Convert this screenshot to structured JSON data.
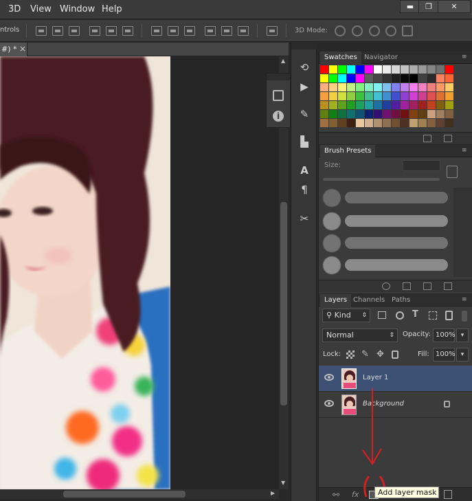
{
  "menu": {
    "items": [
      "3D",
      "View",
      "Window",
      "Help"
    ]
  },
  "window_controls": {
    "minimize": "▬",
    "restore": "❐",
    "close": "✕"
  },
  "options_bar": {
    "label": "ntrols",
    "mode_label": "3D Mode:"
  },
  "document_tab": {
    "title": "#) *",
    "close": "×"
  },
  "swatches_panel": {
    "tabs": [
      "Swatches",
      "Navigator"
    ],
    "colors": [
      [
        "#ff0000",
        "#ffff00",
        "#00ff00",
        "#00ffff",
        "#0000ff",
        "#ff00ff",
        "#ffffff",
        "#ebebeb",
        "#d6d6d6",
        "#c2c2c2",
        "#adadad",
        "#999999",
        "#858585",
        "#707070",
        "#ff0000"
      ],
      [
        "#ffff00",
        "#00ff00",
        "#00ffff",
        "#0000ff",
        "#ff00ff",
        "#5c5c5c",
        "#474747",
        "#333333",
        "#1f1f1f",
        "#0a0a0a",
        "#000000",
        "#404040",
        "#2a2a2a",
        "#ff8060",
        "#ff6633"
      ],
      [
        "#ffb080",
        "#ffd080",
        "#fff080",
        "#c0f080",
        "#80f080",
        "#80f0c0",
        "#80f0f0",
        "#80c0f0",
        "#8080f0",
        "#c080f0",
        "#f080f0",
        "#f080c0",
        "#f08080",
        "#ff9966",
        "#ffcc66"
      ],
      [
        "#f5a040",
        "#f0d040",
        "#d0e040",
        "#90d040",
        "#40c040",
        "#40c090",
        "#40c0d0",
        "#4090d0",
        "#4050d0",
        "#9040d0",
        "#d040d0",
        "#d04090",
        "#e05050",
        "#e07030",
        "#f0a030"
      ],
      [
        "#b89020",
        "#a0b020",
        "#60a020",
        "#20a020",
        "#20a060",
        "#20a0a0",
        "#2070a0",
        "#2040a0",
        "#5020a0",
        "#a020a0",
        "#a02060",
        "#a02020",
        "#c04020",
        "#806010",
        "#a0a010"
      ],
      [
        "#608010",
        "#108010",
        "#107040",
        "#107070",
        "#105070",
        "#102070",
        "#301070",
        "#701070",
        "#701040",
        "#701010",
        "#804010",
        "#604010",
        "#c8a080",
        "#a08060",
        "#806040"
      ],
      [
        "#a07040",
        "#806030",
        "#604020",
        "#402010",
        "#e8c8a0",
        "#d0b090",
        "#b09070",
        "#907050",
        "#705030",
        "#503020",
        "#c0a070",
        "#a08050",
        "#806040",
        "#604030",
        "#403020"
      ]
    ]
  },
  "brush_panel": {
    "tab": "Brush Presets",
    "size_label": "Size:"
  },
  "layers_panel": {
    "tabs": [
      "Layers",
      "Channels",
      "Paths"
    ],
    "kind_label": "Kind",
    "blend_mode": "Normal",
    "opacity_label": "Opacity:",
    "opacity_value": "100%",
    "lock_label": "Lock:",
    "fill_label": "Fill:",
    "fill_value": "100%",
    "layers": [
      {
        "name": "Layer 1",
        "selected": true
      },
      {
        "name": "Background",
        "locked": true
      }
    ],
    "footer": {
      "fx": "fx"
    }
  },
  "tooltip": "Add layer mask",
  "colors": {
    "annotation_red": "#d32020",
    "selection_blue": "#3d5175"
  }
}
